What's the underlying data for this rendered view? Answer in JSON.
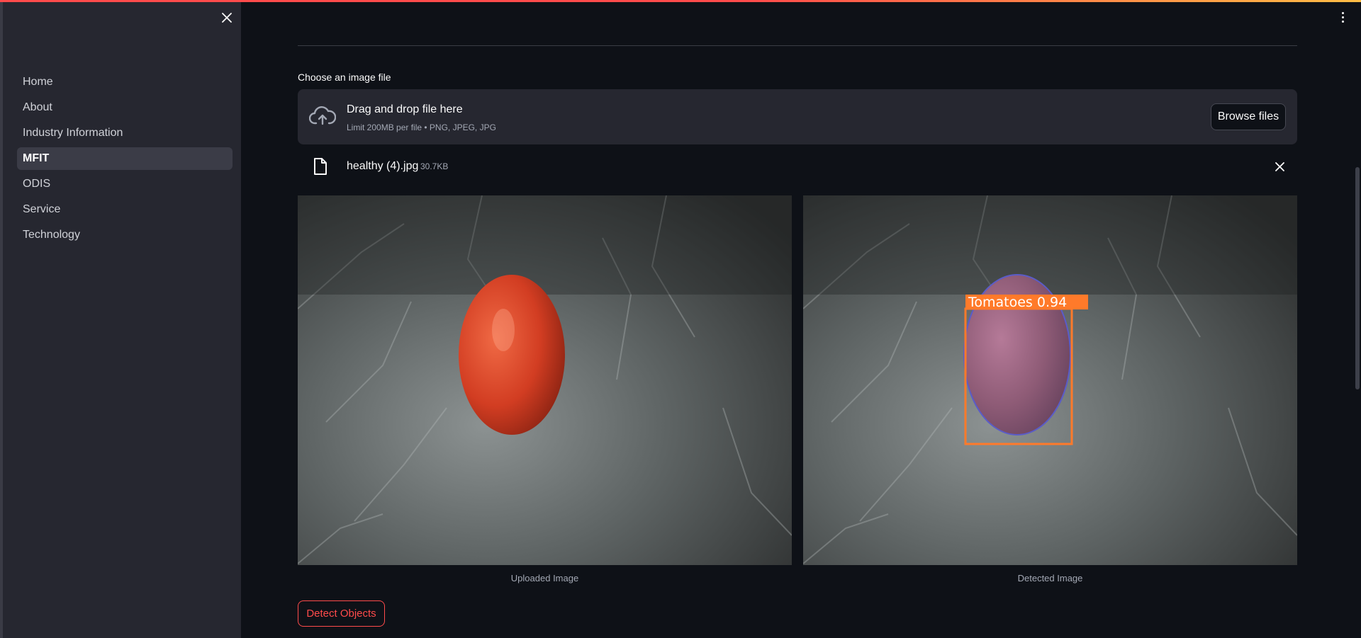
{
  "sidebar": {
    "items": [
      {
        "label": "Home"
      },
      {
        "label": "About"
      },
      {
        "label": "Industry Information"
      },
      {
        "label": "MFIT",
        "active": true
      },
      {
        "label": "ODIS"
      },
      {
        "label": "Service"
      },
      {
        "label": "Technology"
      }
    ]
  },
  "uploader": {
    "label": "Choose an image file",
    "drop_title": "Drag and drop file here",
    "limit_text": "Limit 200MB per file • PNG, JPEG, JPG",
    "browse_label": "Browse files"
  },
  "file": {
    "name": "healthy (4).jpg",
    "size": "30.7KB"
  },
  "images": {
    "uploaded_caption": "Uploaded Image",
    "detected_caption": "Detected Image",
    "detection_label": "Tomatoes 0.94"
  },
  "actions": {
    "detect_label": "Detect Objects"
  },
  "colors": {
    "accent": "#ff4b4b",
    "background": "#0e1117",
    "sidebar": "#262730",
    "detection_box": "#ff7a2a"
  }
}
